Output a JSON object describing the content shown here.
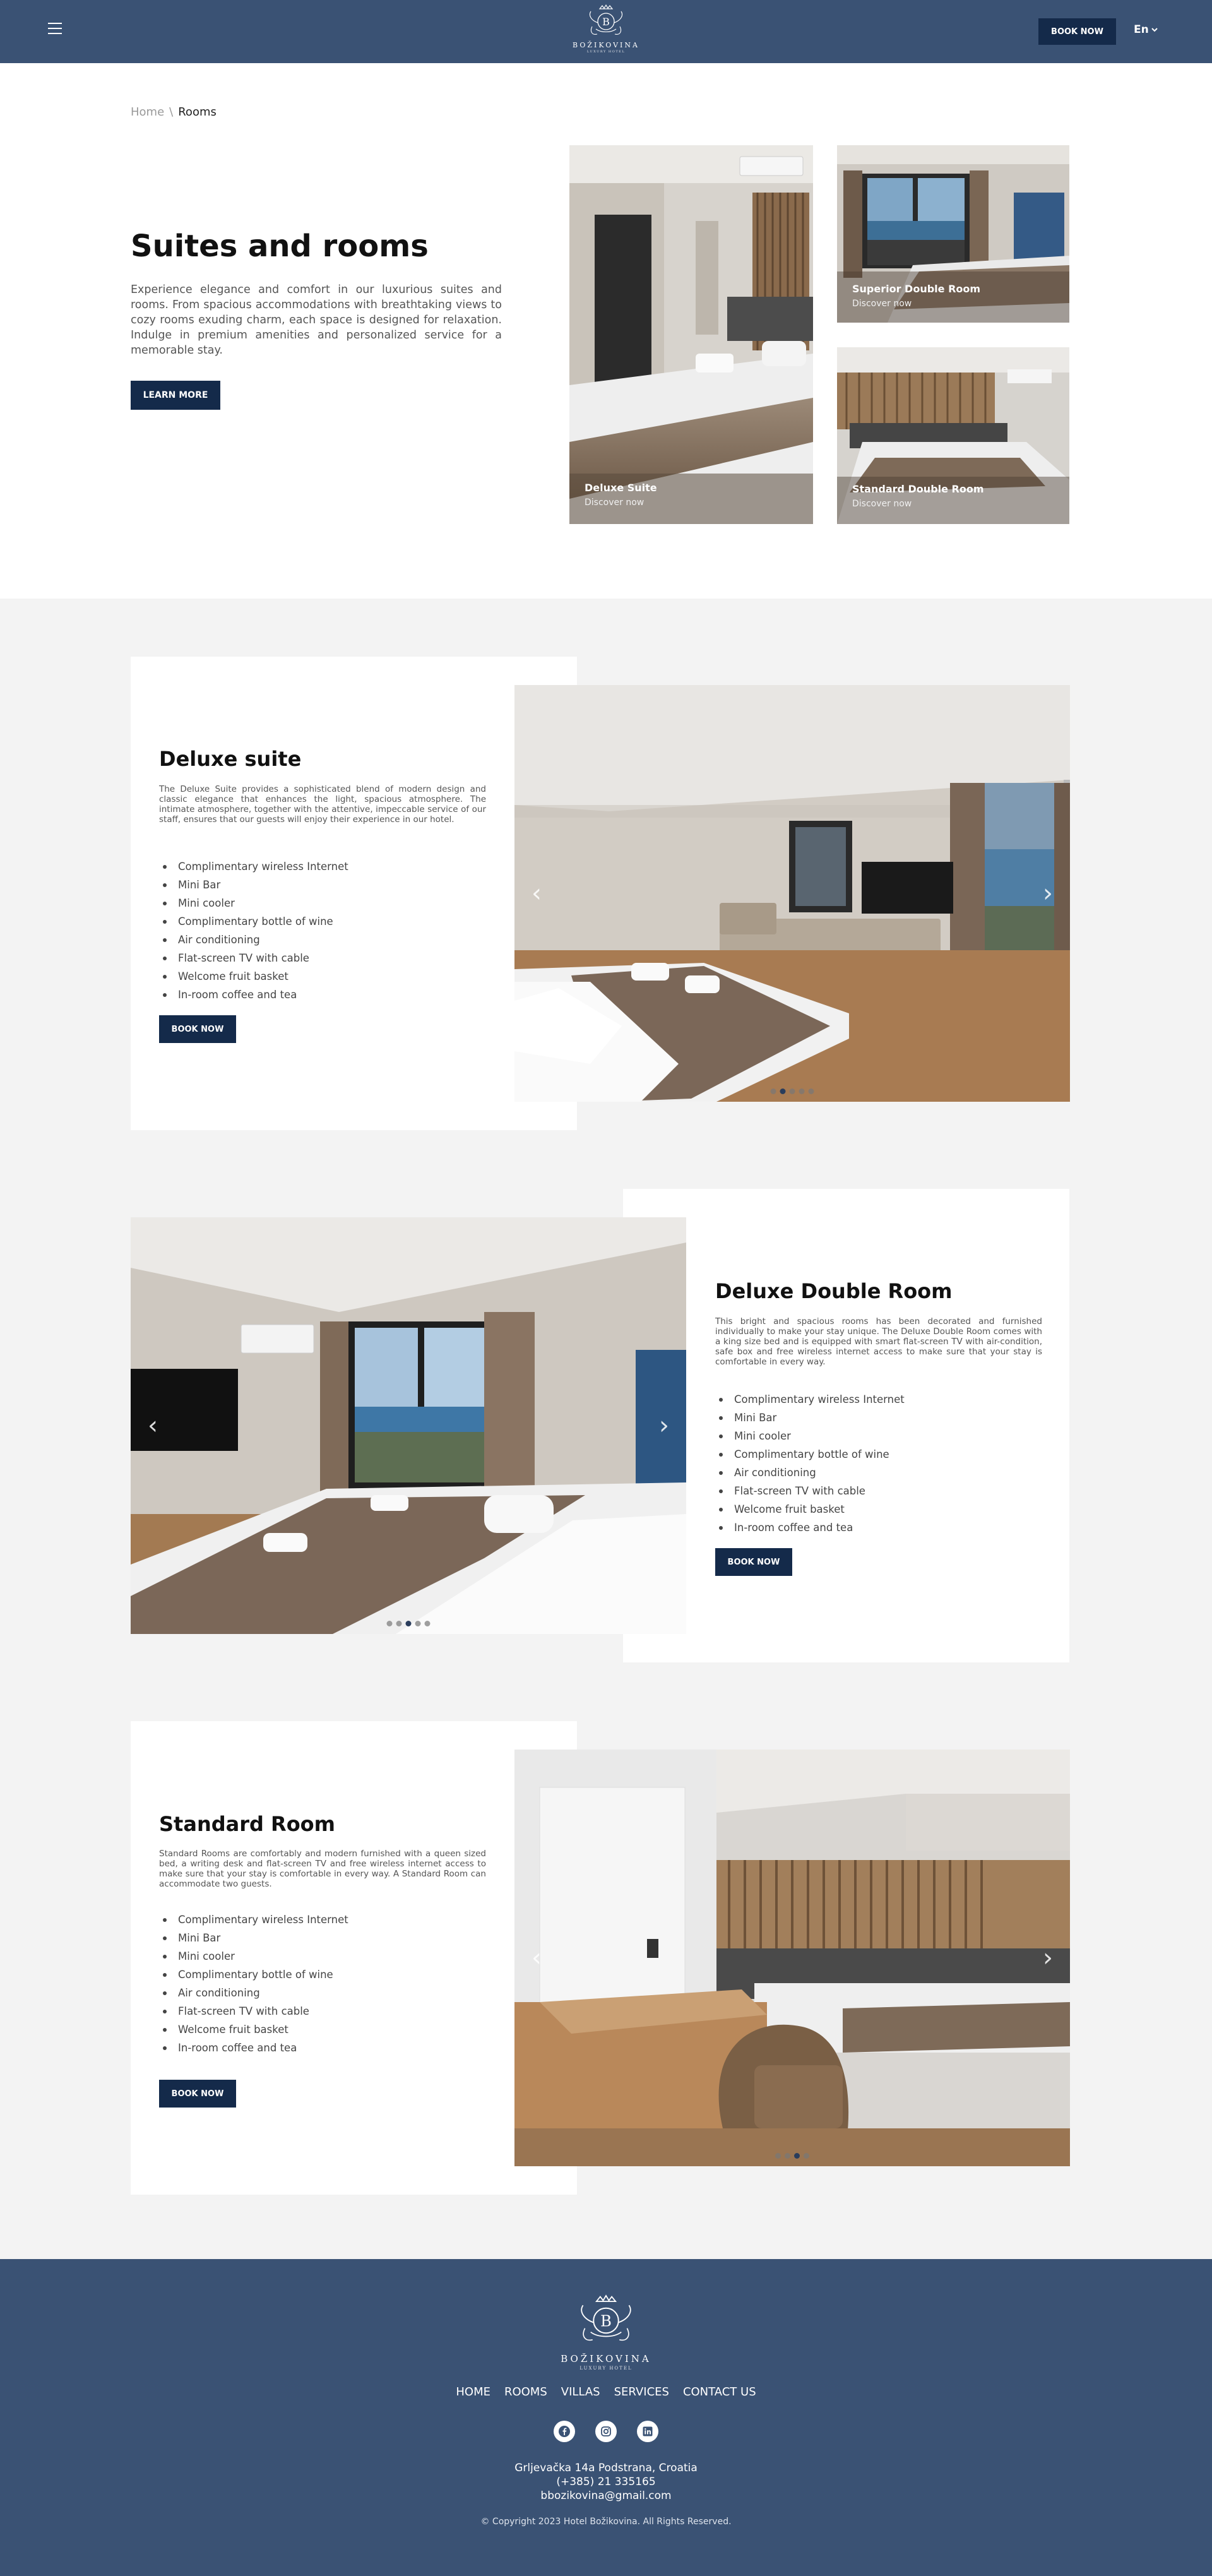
{
  "header": {
    "brand": "BOŽIKOVINA",
    "brand_sub": "LUXURY HOTEL",
    "book_label": "BOOK NOW",
    "language": "En"
  },
  "breadcrumb": {
    "home": "Home",
    "separator": "\\",
    "current": "Rooms"
  },
  "hero": {
    "title": "Suites and rooms",
    "text": "Experience elegance and comfort in our luxurious suites and rooms. From spacious accommodations with breathtaking views to cozy rooms exuding charm, each space is designed for relaxation. Indulge in premium amenities and personalized service for a memorable stay.",
    "button": "LEARN MORE",
    "tiles": [
      {
        "name": "Deluxe Suite",
        "link": "Discover now"
      },
      {
        "name": "Superior Double Room",
        "link": "Discover now"
      },
      {
        "name": "Standard Double Room",
        "link": "Discover now"
      }
    ]
  },
  "amenities": [
    "Complimentary wireless Internet",
    "Mini Bar",
    "Mini cooler",
    "Complimentary bottle of wine",
    "Air conditioning",
    "Flat-screen TV with cable",
    "Welcome fruit basket",
    "In-room coffee and tea"
  ],
  "rooms": [
    {
      "title": "Deluxe suite",
      "description": "The Deluxe Suite provides a sophisticated blend of modern design and classic elegance that enhances the light, spacious atmosphere. The intimate atmosphere, together with the attentive, impeccable service of our staff, ensures that our guests will enjoy their experience in our hotel.",
      "book_label": "BOOK NOW",
      "slides": 5,
      "active_slide": 1
    },
    {
      "title": "Deluxe Double Room",
      "description": "This bright and spacious rooms has been decorated and furnished individually to make your stay unique. The Deluxe Double Room comes with a king size bed and is equipped with smart flat-screen TV with air-condition, safe box and free wireless internet access to make sure that your stay is comfortable in every way.",
      "book_label": "BOOK NOW",
      "slides": 5,
      "active_slide": 2
    },
    {
      "title": "Standard Room",
      "description": "Standard Rooms are comfortably and modern furnished with a queen sized bed, a writing desk and flat-screen TV and free wireless internet access to make sure that your stay is comfortable in every way. A Standard Room can accommodate two guests.",
      "book_label": "BOOK NOW",
      "slides": 4,
      "active_slide": 2
    }
  ],
  "footer": {
    "brand": "BOŽIKOVINA",
    "brand_sub": "LUXURY HOTEL",
    "nav": [
      "HOME",
      "ROOMS",
      "VILLAS",
      "SERVICES",
      "CONTACT US"
    ],
    "socials": [
      "facebook-icon",
      "instagram-icon",
      "linkedin-icon"
    ],
    "address": "Grljevačka 14a Podstrana, Croatia",
    "phone": "(+385) 21 335165",
    "email": "bbozikovina@gmail.com",
    "copyright": "© Copyright 2023 Hotel Božikovina. All Rights Reserved."
  },
  "colors": {
    "navy": "#3a5274",
    "button": "#142a4a",
    "band": "#f3f3f3"
  }
}
